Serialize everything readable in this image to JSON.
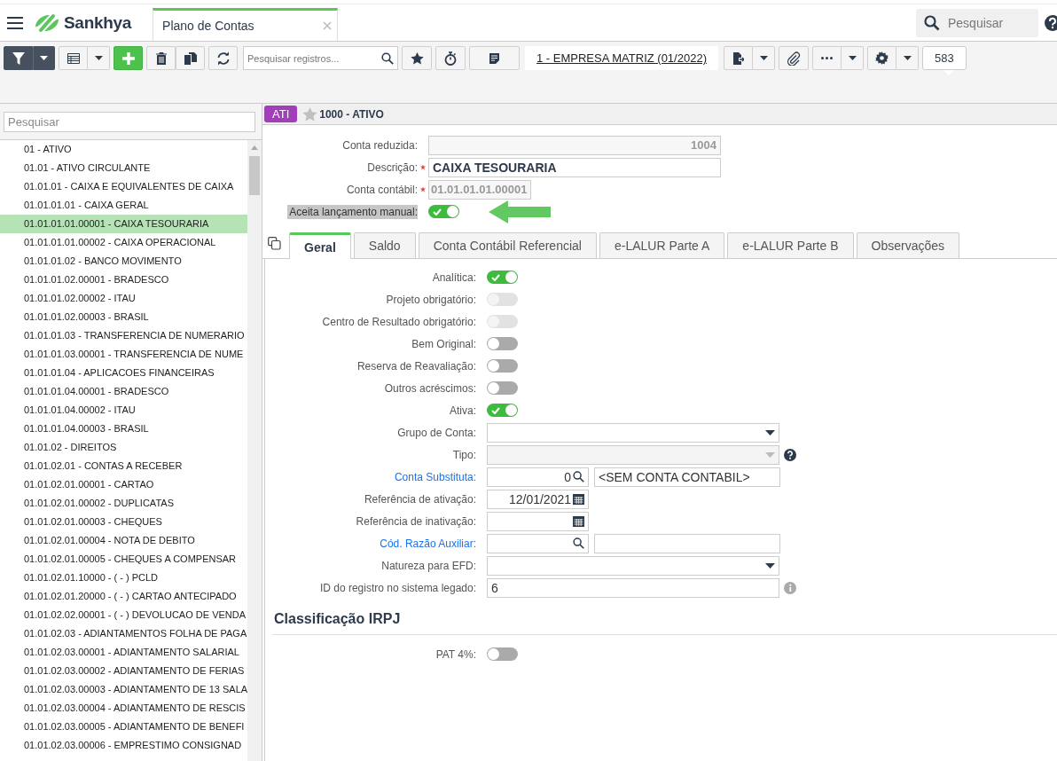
{
  "app": {
    "logo": "Sankhya",
    "search_placeholder": "Pesquisar"
  },
  "tabs": [
    {
      "label": "Plano de Contas",
      "selected": true
    }
  ],
  "toolbar": {
    "search_placeholder": "Pesquisar registros...",
    "company": "1 - EMPRESA MATRIZ (01/2022)",
    "record_count": "583"
  },
  "tree": {
    "search_placeholder": "Pesquisar",
    "items": [
      {
        "label": "01 - ATIVO",
        "selected": false
      },
      {
        "label": "01.01 - ATIVO CIRCULANTE",
        "selected": false
      },
      {
        "label": "01.01.01 - CAIXA E EQUIVALENTES DE CAIXA",
        "selected": false
      },
      {
        "label": "01.01.01.01 - CAIXA GERAL",
        "selected": false
      },
      {
        "label": "01.01.01.01.00001 - CAIXA TESOURARIA",
        "selected": true
      },
      {
        "label": "01.01.01.01.00002 - CAIXA OPERACIONAL",
        "selected": false
      },
      {
        "label": "01.01.01.02 - BANCO MOVIMENTO",
        "selected": false
      },
      {
        "label": "01.01.01.02.00001 - BRADESCO",
        "selected": false
      },
      {
        "label": "01.01.01.02.00002 - ITAU",
        "selected": false
      },
      {
        "label": "01.01.01.02.00003 - BRASIL",
        "selected": false
      },
      {
        "label": "01.01.01.03 - TRANSFERENCIA DE NUMERARIO",
        "selected": false
      },
      {
        "label": "01.01.01.03.00001 - TRANSFERENCIA DE NUME",
        "selected": false
      },
      {
        "label": "01.01.01.04 - APLICACOES FINANCEIRAS",
        "selected": false
      },
      {
        "label": "01.01.01.04.00001 - BRADESCO",
        "selected": false
      },
      {
        "label": "01.01.01.04.00002 - ITAU",
        "selected": false
      },
      {
        "label": "01.01.01.04.00003 - BRASIL",
        "selected": false
      },
      {
        "label": "01.01.02 - DIREITOS",
        "selected": false
      },
      {
        "label": "01.01.02.01 - CONTAS A RECEBER",
        "selected": false
      },
      {
        "label": "01.01.02.01.00001 - CARTAO",
        "selected": false
      },
      {
        "label": "01.01.02.01.00002 - DUPLICATAS",
        "selected": false
      },
      {
        "label": "01.01.02.01.00003 - CHEQUES",
        "selected": false
      },
      {
        "label": "01.01.02.01.00004 - NOTA DE DEBITO",
        "selected": false
      },
      {
        "label": "01.01.02.01.00005 - CHEQUES A COMPENSAR",
        "selected": false
      },
      {
        "label": "01.01.02.01.10000 - ( - ) PCLD",
        "selected": false
      },
      {
        "label": "01.01.02.01.20000 - ( - ) CARTAO ANTECIPADO",
        "selected": false
      },
      {
        "label": "01.01.02.02.00001 - ( - ) DEVOLUCAO DE VENDA",
        "selected": false
      },
      {
        "label": "01.01.02.03 - ADIANTAMENTOS FOLHA DE PAGA",
        "selected": false
      },
      {
        "label": "01.01.02.03.00001 - ADIANTAMENTO SALARIAL",
        "selected": false
      },
      {
        "label": "01.01.02.03.00002 - ADIANTAMENTO DE FERIAS",
        "selected": false
      },
      {
        "label": "01.01.02.03.00003 - ADIANTAMENTO DE 13 SALA",
        "selected": false
      },
      {
        "label": "01.01.02.03.00004 - ADIANTAMENTO DE RESCIS",
        "selected": false
      },
      {
        "label": "01.01.02.03.00005 - ADIANTAMENTO DE BENEFI",
        "selected": false
      },
      {
        "label": "01.01.02.03.00006 - EMPRESTIMO CONSIGNAD",
        "selected": false
      }
    ]
  },
  "record": {
    "badge": "ATI",
    "title": "1000 - ATIVO",
    "favorite": false
  },
  "header_fields": [
    {
      "label": "Conta reduzida:",
      "kind": "readonly",
      "value": "1004"
    },
    {
      "label": "Descrição:",
      "kind": "text",
      "required": true,
      "value": "CAIXA TESOURARIA"
    },
    {
      "label": "Conta contábil:",
      "kind": "code",
      "required": true,
      "value": "01.01.01.01.00001"
    },
    {
      "label": "Aceita lançamento manual:",
      "kind": "toggle",
      "on": true,
      "highlighted": true
    }
  ],
  "detail_tabs": [
    {
      "label": "Geral",
      "selected": true
    },
    {
      "label": "Saldo",
      "selected": false
    },
    {
      "label": "Conta Contábil Referencial",
      "selected": false
    },
    {
      "label": "e-LALUR Parte A",
      "selected": false
    },
    {
      "label": "e-LALUR Parte B",
      "selected": false
    },
    {
      "label": "Observações",
      "selected": false
    }
  ],
  "fields": [
    {
      "label": "Analítica:",
      "kind": "toggle",
      "link": false,
      "on": true,
      "disabled": false
    },
    {
      "label": "Projeto obrigatório:",
      "kind": "toggle",
      "link": false,
      "on": false,
      "disabled": true
    },
    {
      "label": "Centro de Resultado obrigatório:",
      "kind": "toggle",
      "link": false,
      "on": false,
      "disabled": true
    },
    {
      "label": "Bem Original:",
      "kind": "toggle",
      "link": false,
      "on": false,
      "disabled": false
    },
    {
      "label": "Reserva de Reavaliação:",
      "kind": "toggle",
      "link": false,
      "on": false,
      "disabled": false
    },
    {
      "label": "Outros acréscimos:",
      "kind": "toggle",
      "link": false,
      "on": false,
      "disabled": false
    },
    {
      "label": "Ativa:",
      "kind": "toggle",
      "link": false,
      "on": true,
      "disabled": false
    },
    {
      "label": "Grupo de Conta:",
      "kind": "select",
      "link": false,
      "disabled": false
    },
    {
      "label": "Tipo:",
      "kind": "select",
      "link": false,
      "disabled": true,
      "help_icon": true
    },
    {
      "label": "Conta Substituta:",
      "kind": "lookup",
      "link": true,
      "value": "0",
      "description": "<SEM CONTA CONTABIL>"
    },
    {
      "label": "Referência de ativação:",
      "kind": "date",
      "link": false,
      "value": "12/01/2021"
    },
    {
      "label": "Referência de inativação:",
      "kind": "date",
      "link": false
    },
    {
      "label": "Cód. Razão Auxiliar:",
      "kind": "lookup",
      "link": true
    },
    {
      "label": "Natureza para EFD:",
      "kind": "select",
      "link": false,
      "disabled": false
    },
    {
      "label": "ID do registro no sistema legado:",
      "kind": "text",
      "link": false,
      "value": "6",
      "info_icon": true
    }
  ],
  "sections": [
    {
      "title": "Classificação IRPJ",
      "fields": [
        {
          "label": "PAT 4%:",
          "kind": "toggle",
          "link": false,
          "on": false,
          "disabled": false
        }
      ]
    }
  ]
}
